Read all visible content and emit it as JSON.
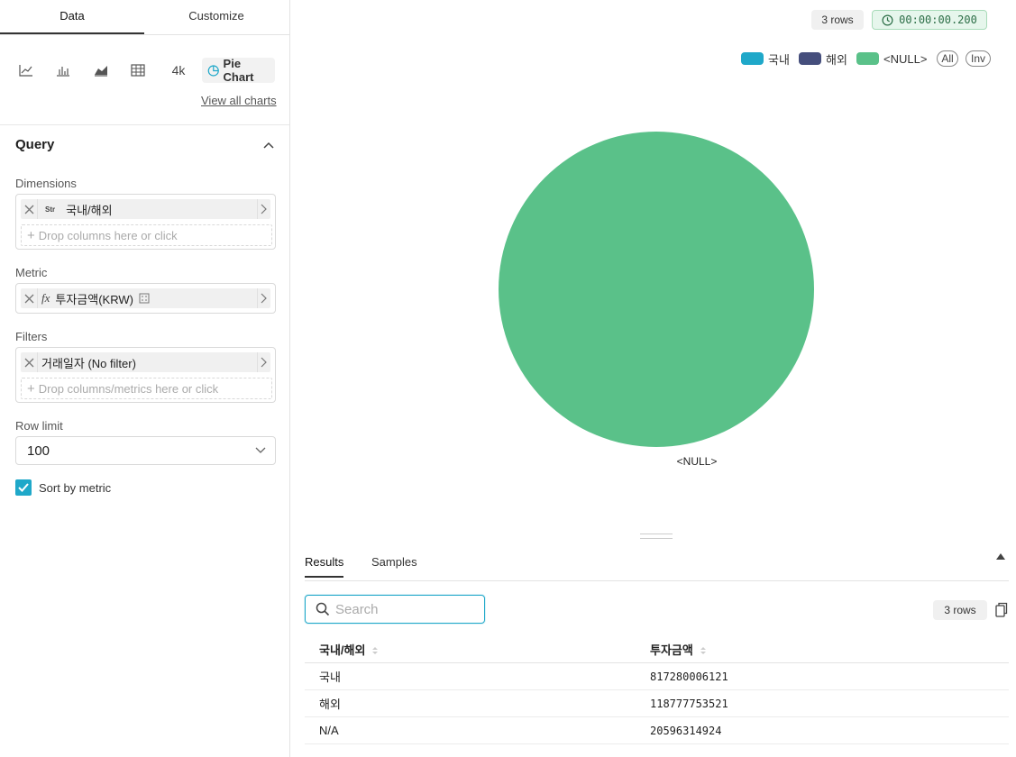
{
  "tabs": {
    "data": "Data",
    "customize": "Customize"
  },
  "viz": {
    "big_number": "4k",
    "pie_chart": "Pie Chart",
    "view_all": "View all charts"
  },
  "query": {
    "title": "Query",
    "dimensions_label": "Dimensions",
    "dimension_type": "Str",
    "dimension_value": "국내/해외",
    "dimension_drop": "Drop columns here or click",
    "metric_label": "Metric",
    "metric_prefix": "fx",
    "metric_value": "투자금액(KRW)",
    "filters_label": "Filters",
    "filter_value": "거래일자 (No filter)",
    "filter_drop": "Drop columns/metrics here or click",
    "row_limit_label": "Row limit",
    "row_limit_value": "100",
    "sort_by_metric": "Sort by metric"
  },
  "header": {
    "rows": "3 rows",
    "time": "00:00:00.200"
  },
  "legend": {
    "items": [
      {
        "label": "국내",
        "color": "#1fa8c9"
      },
      {
        "label": "해외",
        "color": "#454e7c"
      },
      {
        "label": "<NULL>",
        "color": "#5ac189"
      }
    ],
    "all": "All",
    "inv": "Inv"
  },
  "chart_data": {
    "type": "pie",
    "categories": [
      "국내",
      "해외",
      "<NULL>"
    ],
    "values": [
      817280006121,
      118777753521,
      20596314924
    ],
    "visible": [
      false,
      false,
      true
    ],
    "colors": [
      "#1fa8c9",
      "#454e7c",
      "#5ac189"
    ],
    "slice_labels": [
      "<NULL>"
    ],
    "legend_position": "top-right"
  },
  "results": {
    "tab_results": "Results",
    "tab_samples": "Samples",
    "search_placeholder": "Search",
    "rows": "3 rows",
    "columns": [
      "국내/해외",
      "투자금액"
    ],
    "rows_data": [
      {
        "c1": "국내",
        "c2": "817280006121",
        "na": false
      },
      {
        "c1": "해외",
        "c2": "118777753521",
        "na": false
      },
      {
        "c1": "N/A",
        "c2": "20596314924",
        "na": true
      }
    ]
  }
}
